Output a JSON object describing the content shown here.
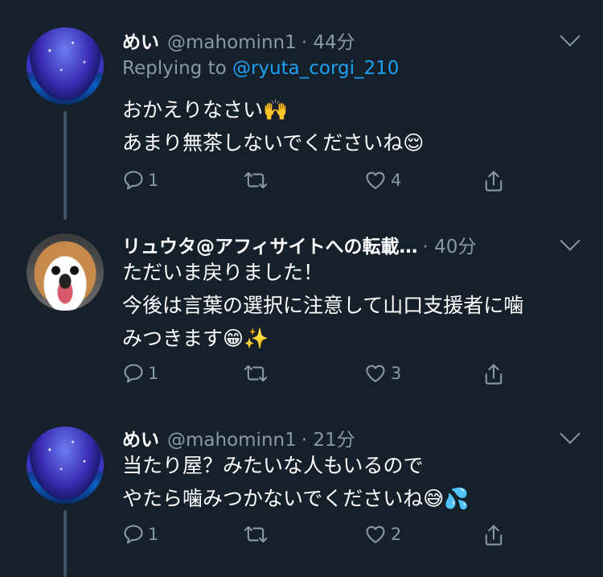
{
  "tweets": [
    {
      "name": "めい",
      "handle": "@mahominn1",
      "time": "· 44分",
      "replying_prefix": "Replying to",
      "replying_to": "@ryuta_corgi_210",
      "lines": [
        "おかえりなさい🙌",
        "あまり無茶しないでくださいね😌"
      ],
      "replies": "1",
      "retweets": "",
      "likes": "4"
    },
    {
      "name": "リュウタ@アフィサイトへの転載…",
      "handle": "",
      "time": "· 40分",
      "lines": [
        "ただいま戻りました！",
        "今後は言葉の選択に注意して山口支援者に噛",
        "みつきます😁✨"
      ],
      "replies": "1",
      "retweets": "",
      "likes": "3"
    },
    {
      "name": "めい",
      "handle": "@mahominn1",
      "time": "· 21分",
      "lines": [
        "当たり屋？みたいな人もいるので",
        "やたら噛みつかないでくださいね😅💦"
      ],
      "replies": "1",
      "retweets": "",
      "likes": "2"
    }
  ],
  "icons": {
    "reply": "reply-icon",
    "retweet": "retweet-icon",
    "like": "heart-icon",
    "share": "share-icon",
    "more": "chevron-down-icon"
  },
  "colors": {
    "background": "#15202b",
    "secondary_text": "#8899a6",
    "link": "#1da1f2",
    "thread_line": "#3d5466"
  }
}
